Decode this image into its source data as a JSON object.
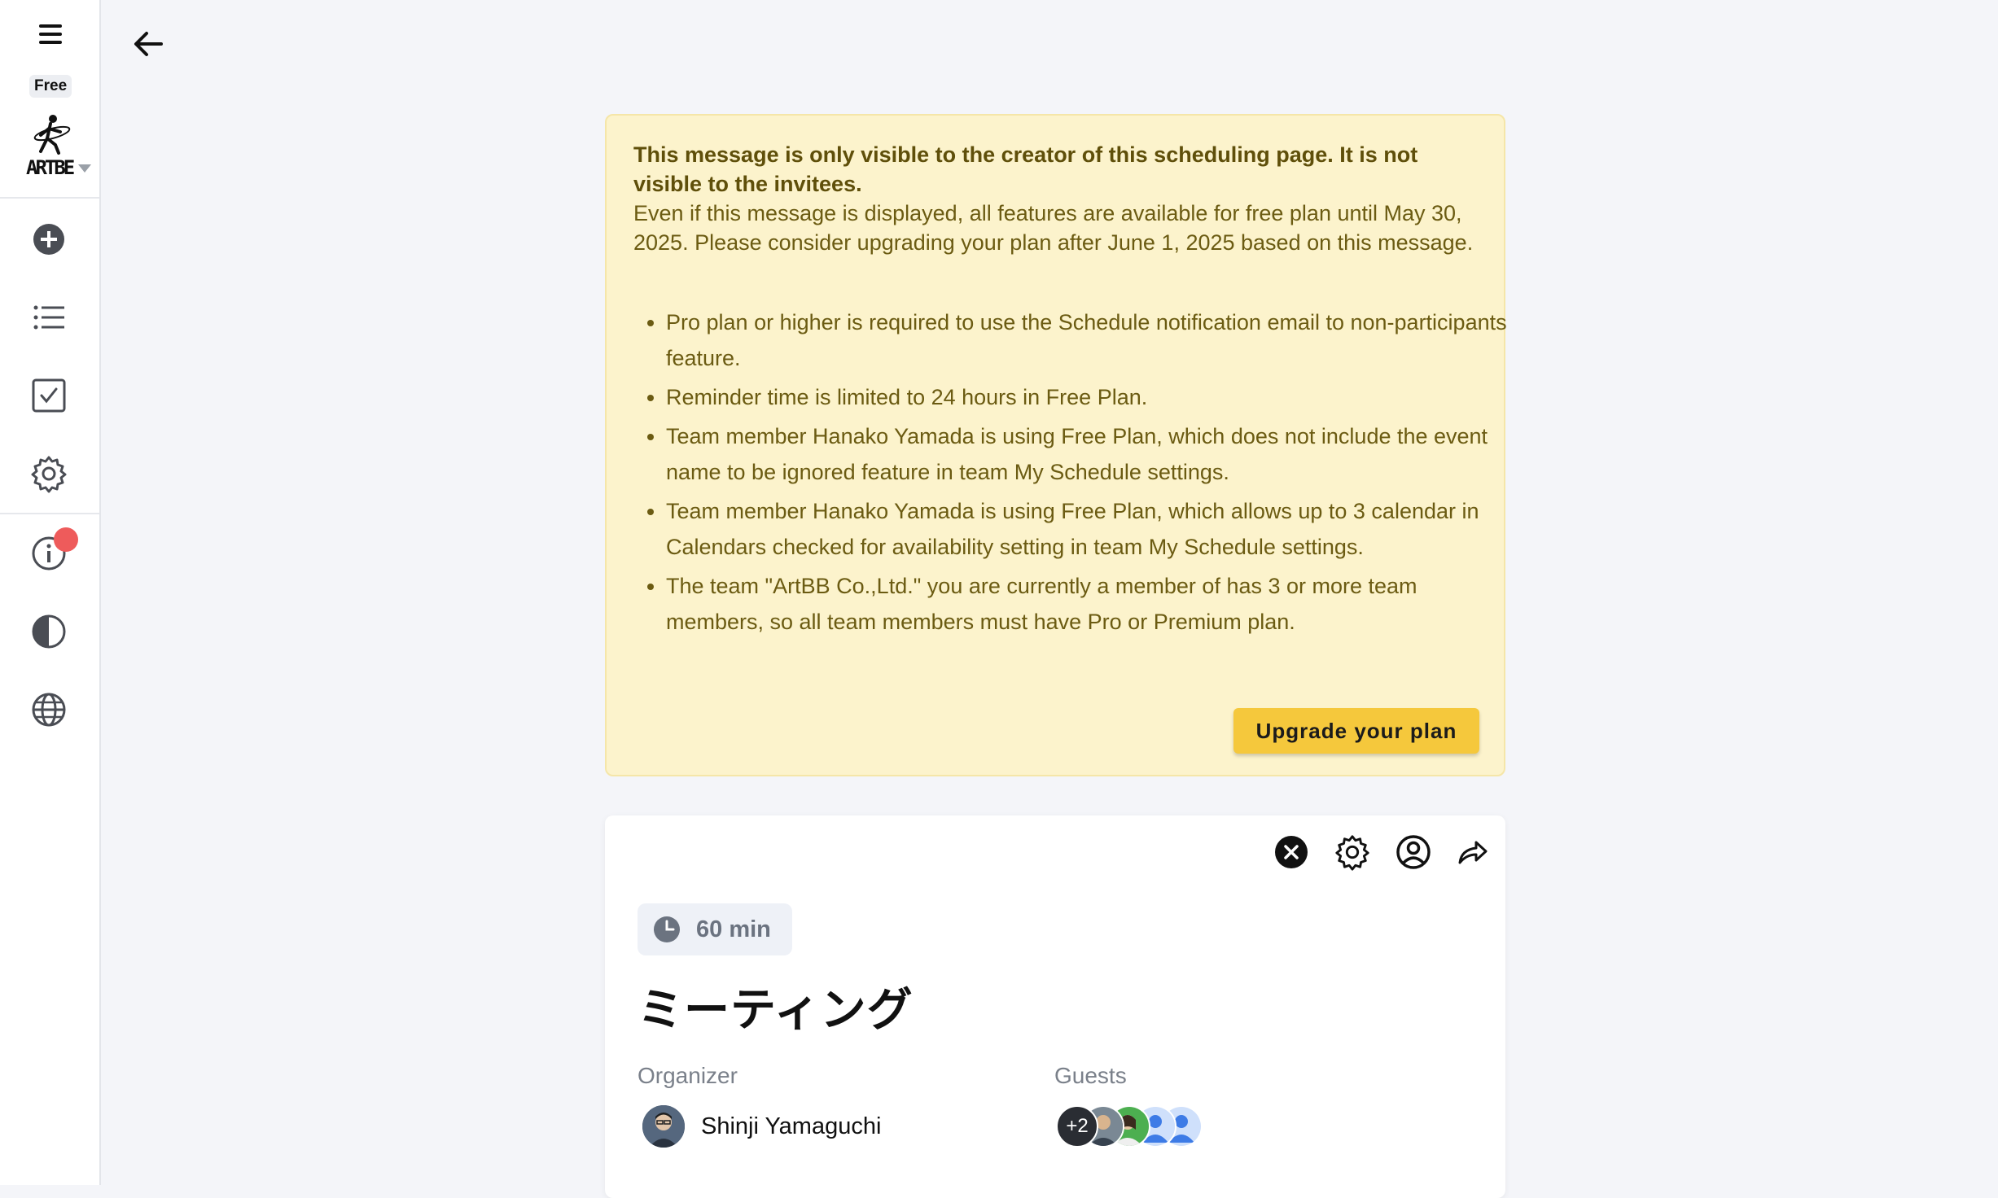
{
  "sidebar": {
    "plan_badge": "Free",
    "logo_text": "ARTBE",
    "icons": [
      "menu-icon",
      "plus-circle-icon",
      "list-icon",
      "checkbox-icon",
      "gear-icon",
      "info-icon",
      "contrast-icon",
      "globe-icon"
    ],
    "notification_dot_color": "#ee5b5b"
  },
  "header": {
    "back_icon": "arrow-left-icon"
  },
  "notice": {
    "title": "This message is only visible to the creator of this scheduling page. It is not visible to the invitees.",
    "body": "Even if this message is displayed, all features are available for free plan until May 30, 2025. Please consider upgrading your plan after June 1, 2025 based on this message.",
    "items": [
      "Pro plan or higher is required to use the Schedule notification email to non-participants feature.",
      "Reminder time is limited to 24 hours in Free Plan.",
      "Team member Hanako Yamada is using Free Plan, which does not include the event name to be ignored feature in team My Schedule settings.",
      "Team member Hanako Yamada is using Free Plan, which allows up to 3 calendar in Calendars checked for availability setting in team My Schedule settings.",
      "The team \"ArtBB Co.,Ltd.\" you are currently a member of has 3 or more team members, so all team members must have Pro or Premium plan."
    ],
    "upgrade_label": "Upgrade your plan",
    "background": "#fcf3cc",
    "button_color": "#f5c83c"
  },
  "event": {
    "duration": "60 min",
    "title": "ミーティング",
    "organizer_label": "Organizer",
    "organizer_name": "Shinji Yamaguchi",
    "guests_label": "Guests",
    "guests_more": "+2",
    "toolbar_icons": [
      "close-icon",
      "gear-icon",
      "user-circle-icon",
      "share-icon"
    ]
  }
}
